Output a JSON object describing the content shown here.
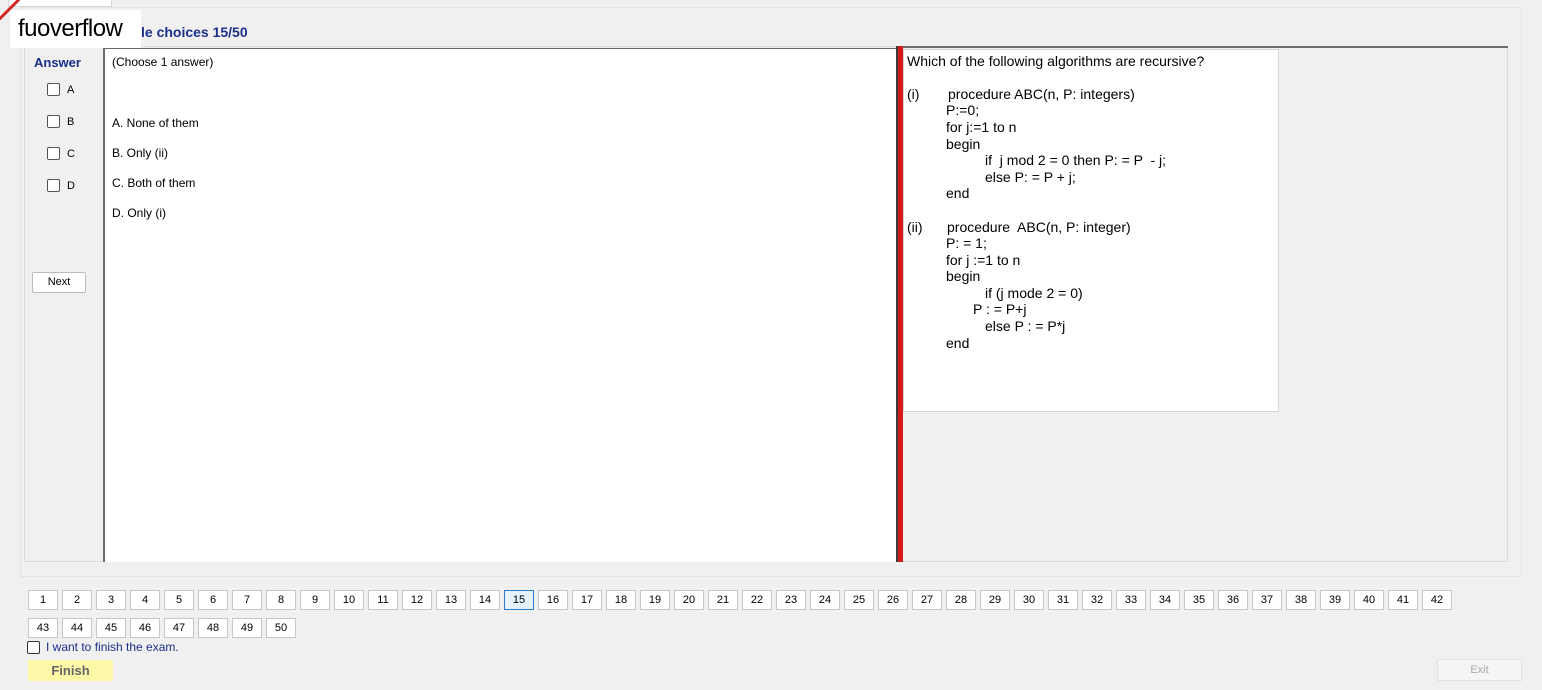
{
  "header": {
    "watermark": "fuoverflow",
    "section_title": "le choices 15/50"
  },
  "answer_panel": {
    "heading": "Answer",
    "options": [
      "A",
      "B",
      "C",
      "D"
    ],
    "next_label": "Next"
  },
  "choices": {
    "instruction": "(Choose 1 answer)",
    "items": [
      "A.  None of them",
      "B.  Only (ii)",
      "C.  Both of them",
      "D.  Only (i)"
    ]
  },
  "question": {
    "title": "Which of the following algorithms are recursive?",
    "lines": [
      "(i)",
      "procedure ABC(n, P: integers)",
      "P:=0;",
      "for j:=1 to n",
      "begin",
      "if  j mod 2 = 0 then P: = P  - j;",
      "else P: = P + j;",
      "end",
      "(ii)",
      "procedure  ABC(n, P: integer)",
      "P: = 1;",
      "for j :=1 to n",
      "begin",
      "if (j mode 2 = 0)",
      "P : = P+j",
      "else P : = P*j",
      "end"
    ]
  },
  "pagination": {
    "current": 15,
    "pages_row1": [
      "1",
      "2",
      "3",
      "4",
      "5",
      "6",
      "7",
      "8",
      "9",
      "10",
      "11",
      "12",
      "13",
      "14",
      "15",
      "16",
      "17",
      "18",
      "19",
      "20",
      "21",
      "22",
      "23",
      "24",
      "25",
      "26",
      "27",
      "28",
      "29",
      "30",
      "31",
      "32",
      "33",
      "34",
      "35",
      "36",
      "37",
      "38",
      "39",
      "40",
      "41",
      "42"
    ],
    "pages_row2": [
      "43",
      "44",
      "45",
      "46",
      "47",
      "48",
      "49",
      "50"
    ]
  },
  "footer": {
    "finish_checkbox_label": "I want to finish the exam.",
    "finish_label": "Finish",
    "exit_label": "Exit"
  },
  "colors": {
    "title_blue": "#1a2f8a",
    "divider_red": "#d21a1a",
    "finish_yellow": "#fdf7a8",
    "current_page_border": "#2a7fd4"
  }
}
